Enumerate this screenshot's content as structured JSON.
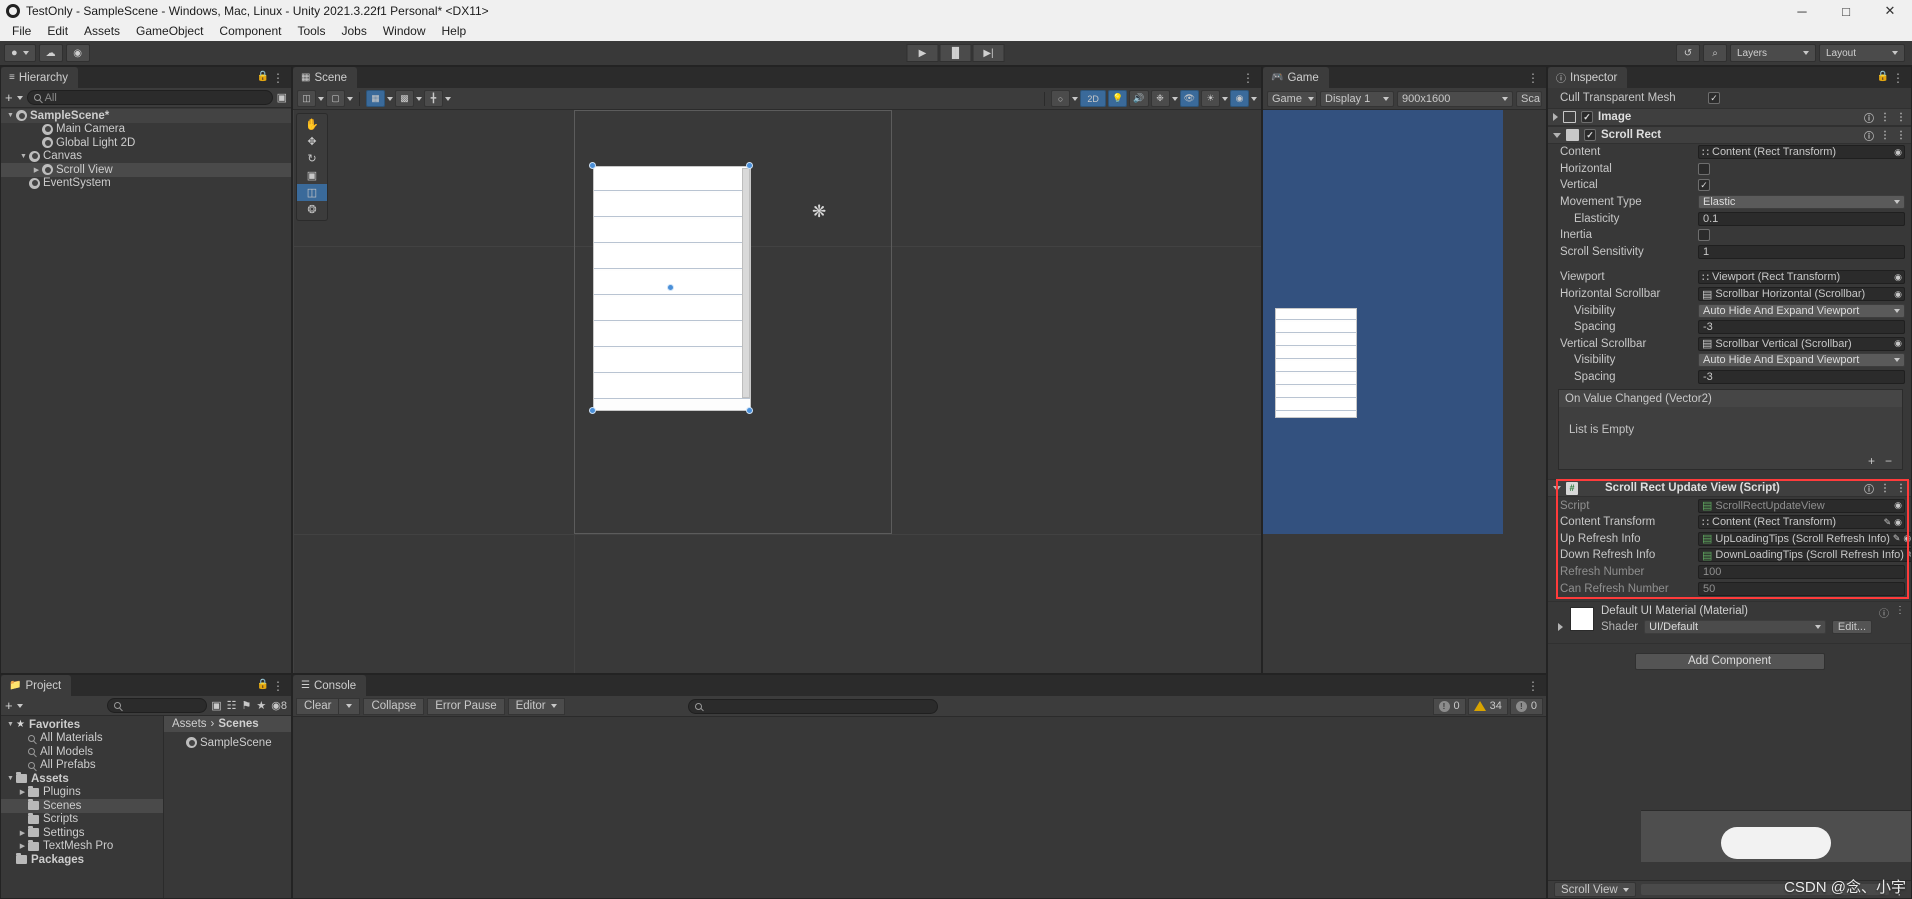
{
  "window": {
    "title": "TestOnly - SampleScene - Windows, Mac, Linux - Unity 2021.3.22f1 Personal* <DX11>",
    "minimize": "─",
    "maximize": "□",
    "close": "✕"
  },
  "menubar": {
    "items": [
      "File",
      "Edit",
      "Assets",
      "GameObject",
      "Component",
      "Tools",
      "Jobs",
      "Window",
      "Help"
    ]
  },
  "maintoolbar": {
    "account_label": "",
    "play": "▶",
    "pause": "▐▌",
    "step": "▶|",
    "history": "↺",
    "search": "⌕",
    "layers": "Layers",
    "layout": "Layout"
  },
  "hierarchy": {
    "tab": "Hierarchy",
    "create_label": "+",
    "search_placeholder": "All",
    "items": [
      {
        "label": "SampleScene*",
        "depth": 0,
        "icon": "unity-scene-icon",
        "expanded": true,
        "selected": false
      },
      {
        "label": "Main Camera",
        "depth": 2,
        "icon": "cube-icon",
        "expanded": null,
        "selected": false
      },
      {
        "label": "Global Light 2D",
        "depth": 2,
        "icon": "cube-icon",
        "expanded": null,
        "selected": false
      },
      {
        "label": "Canvas",
        "depth": 1,
        "icon": "cube-icon",
        "expanded": true,
        "selected": false
      },
      {
        "label": "Scroll View",
        "depth": 2,
        "icon": "cube-icon",
        "expanded": false,
        "selected": true
      },
      {
        "label": "EventSystem",
        "depth": 1,
        "icon": "cube-icon",
        "expanded": null,
        "selected": false
      }
    ]
  },
  "scene": {
    "tab": "Scene",
    "toolbar": {
      "shading_mode": "shaded-icon",
      "draw_mode": "draw-mode-icon",
      "grid_visibility": "grid-icon",
      "grid_snap": "grid-snap-icon",
      "ruler": "ruler-icon",
      "fx": "fx-icon",
      "two_d": "2D",
      "lighting": "light-bulb-icon",
      "audio": "audio-mute-icon",
      "effects": "effects-icon",
      "hidden": "visibility-off-icon",
      "camera": "camera-icon",
      "gizmos": "gizmos-icon"
    },
    "tools": [
      "hand-tool",
      "move-tool",
      "rotate-tool",
      "scale-tool",
      "rect-tool",
      "transform-tool"
    ],
    "active_tool_index": 4
  },
  "game": {
    "tab": "Game",
    "display": "Display 1",
    "resolution": "900x1600",
    "scale_label": "Sca"
  },
  "project": {
    "tab": "Project",
    "create_label": "+",
    "search_placeholder": "",
    "breadcrumb": [
      "Assets",
      "Scenes"
    ],
    "favorites": {
      "label": "Favorites",
      "items": [
        "All Materials",
        "All Models",
        "All Prefabs"
      ]
    },
    "assets": {
      "label": "Assets",
      "items": [
        {
          "label": "Plugins",
          "expandable": true,
          "selected": false
        },
        {
          "label": "Scenes",
          "expandable": false,
          "selected": true
        },
        {
          "label": "Scripts",
          "expandable": false,
          "selected": false
        },
        {
          "label": "Settings",
          "expandable": true,
          "selected": false
        },
        {
          "label": "TextMesh Pro",
          "expandable": true,
          "selected": false
        }
      ]
    },
    "packages": {
      "label": "Packages"
    },
    "files": [
      {
        "label": "SampleScene",
        "icon": "unity-scene-icon"
      }
    ]
  },
  "console": {
    "tab": "Console",
    "clear": "Clear",
    "collapse": "Collapse",
    "error_pause": "Error Pause",
    "editor": "Editor",
    "search_placeholder": "",
    "counts": {
      "logs": "0",
      "warnings": "34",
      "errors": "0"
    }
  },
  "inspector": {
    "tab": "Inspector",
    "cull_transparent_mesh": {
      "label": "Cull Transparent Mesh",
      "checked": true
    },
    "components": [
      {
        "name": "Image",
        "enabled": true,
        "expanded": false,
        "icon": "image-icon"
      },
      {
        "name": "Scroll Rect",
        "enabled": true,
        "expanded": true,
        "icon": "scrollrect-icon"
      }
    ],
    "scroll_rect": {
      "rows": [
        {
          "label": "Content",
          "type": "object",
          "value": "Content (Rect Transform)",
          "indent": 0
        },
        {
          "label": "Horizontal",
          "type": "check",
          "value": false,
          "indent": 0
        },
        {
          "label": "Vertical",
          "type": "check",
          "value": true,
          "indent": 0
        },
        {
          "label": "Movement Type",
          "type": "dropdown",
          "value": "Elastic",
          "indent": 0
        },
        {
          "label": "Elasticity",
          "type": "number",
          "value": "0.1",
          "indent": 1
        },
        {
          "label": "Inertia",
          "type": "check",
          "value": false,
          "indent": 0
        },
        {
          "label": "Scroll Sensitivity",
          "type": "number",
          "value": "1",
          "indent": 0
        },
        {
          "label": "",
          "type": "spacer",
          "value": "",
          "indent": 0
        },
        {
          "label": "Viewport",
          "type": "object",
          "value": "Viewport (Rect Transform)",
          "indent": 0
        },
        {
          "label": "Horizontal Scrollbar",
          "type": "object-s",
          "value": "Scrollbar Horizontal (Scrollbar)",
          "indent": 0
        },
        {
          "label": "Visibility",
          "type": "dropdown",
          "value": "Auto Hide And Expand Viewport",
          "indent": 1
        },
        {
          "label": "Spacing",
          "type": "number",
          "value": "-3",
          "indent": 1
        },
        {
          "label": "Vertical Scrollbar",
          "type": "object-s",
          "value": "Scrollbar Vertical (Scrollbar)",
          "indent": 0
        },
        {
          "label": "Visibility",
          "type": "dropdown",
          "value": "Auto Hide And Expand Viewport",
          "indent": 1
        },
        {
          "label": "Spacing",
          "type": "number",
          "value": "-3",
          "indent": 1
        }
      ],
      "event": {
        "title": "On Value Changed (Vector2)",
        "empty_text": "List is Empty",
        "add": "+",
        "remove": "−"
      }
    },
    "script_component": {
      "title": "Scroll Rect Update View (Script)",
      "highlight_color": "#ff3b3b",
      "rows": [
        {
          "label": "Script",
          "type": "script",
          "value": "ScrollRectUpdateView",
          "disabled": true
        },
        {
          "label": "Content Transform",
          "type": "object",
          "value": "Content (Rect Transform)",
          "disabled": false
        },
        {
          "label": "Up Refresh Info",
          "type": "script-obj",
          "value": "UpLoadingTips (Scroll Refresh Info)",
          "disabled": false
        },
        {
          "label": "Down Refresh Info",
          "type": "script-obj",
          "value": "DownLoadingTips (Scroll Refresh Info)",
          "disabled": false
        },
        {
          "label": "Refresh Number",
          "type": "number",
          "value": "100",
          "disabled": true
        },
        {
          "label": "Can Refresh Number",
          "type": "number",
          "value": "50",
          "disabled": true
        }
      ]
    },
    "material": {
      "title": "Default UI Material (Material)",
      "shader_label": "Shader",
      "shader_value": "UI/Default",
      "edit_label": "Edit..."
    },
    "add_component": "Add Component",
    "footer_tab": "Scroll View"
  },
  "watermark": "CSDN @念、小宇"
}
